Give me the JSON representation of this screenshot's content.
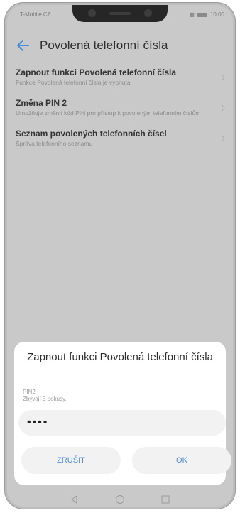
{
  "status_bar": {
    "carrier": "T-Mobile CZ",
    "time": "10:00",
    "icons": [
      "signal-icon",
      "vibrate-icon",
      "battery-icon"
    ]
  },
  "app_bar": {
    "title": "Povolená telefonní čísla",
    "back_icon": "arrow-left-icon"
  },
  "settings": {
    "items": [
      {
        "title": "Zapnout funkci Povolená telefonní čísla",
        "subtitle": "Funkce Povolená telefonní čísla je vypnuta"
      },
      {
        "title": "Změna PIN 2",
        "subtitle": "Umožňuje změnit kód PIN pro přístup k povoleným telefonním číslům"
      },
      {
        "title": "Seznam povolených telefonních čísel",
        "subtitle": "Správa telefonního seznamu"
      }
    ]
  },
  "dialog": {
    "title": "Zapnout funkci Povolená telefonní čísla",
    "field_label": "PIN2",
    "hint": "Zbývají 3 pokusy.",
    "pin_value": "••••",
    "cancel_label": "ZRUŠIT",
    "ok_label": "OK"
  },
  "nav_bar": {
    "icons": [
      "back-triangle-icon",
      "home-circle-icon",
      "recents-square-icon"
    ]
  },
  "colors": {
    "accent": "#4a8de0",
    "dim_overlay": "#c9c9c9"
  }
}
